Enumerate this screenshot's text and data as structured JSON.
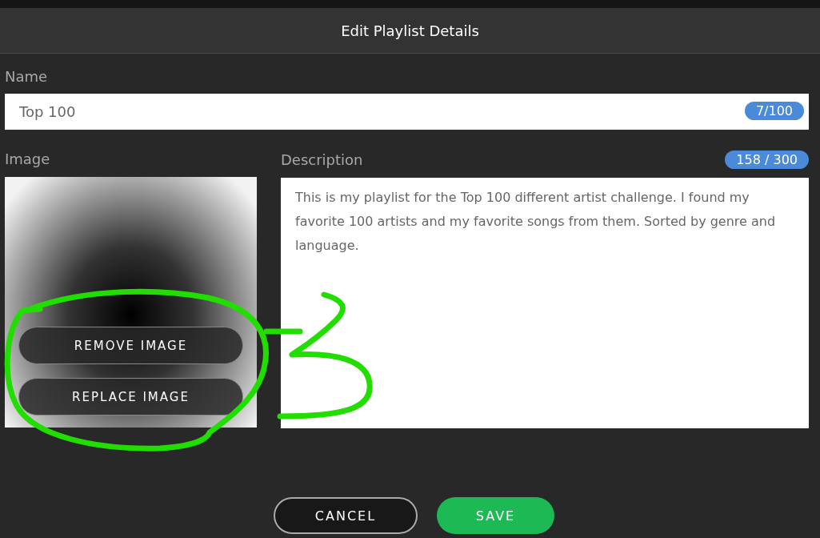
{
  "dialog": {
    "title": "Edit Playlist Details"
  },
  "name_field": {
    "label": "Name",
    "value": "Top 100",
    "count": "7/100"
  },
  "image": {
    "label": "Image",
    "buttons": [
      "REMOVE IMAGE",
      "REPLACE IMAGE"
    ]
  },
  "description": {
    "label": "Description",
    "count": "158 / 300",
    "value": "This is my playlist for the Top 100 different artist challenge. I found my favorite 100 artists and my favorite songs from them. Sorted by genre and language."
  },
  "buttons": [
    {
      "label": "CANCEL",
      "kind": "secondary"
    },
    {
      "label": "SAVE",
      "kind": "primary"
    }
  ]
}
